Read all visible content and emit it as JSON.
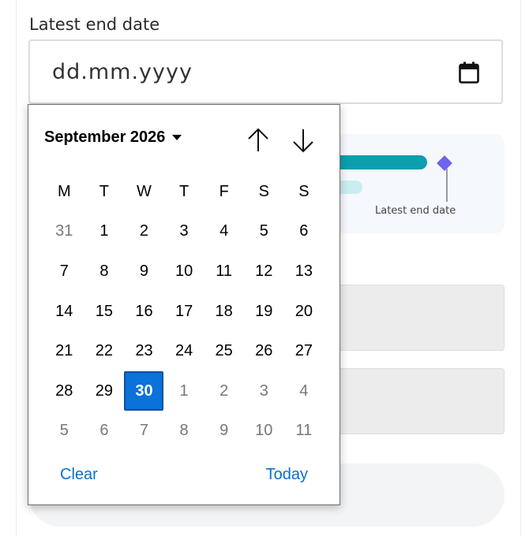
{
  "field": {
    "label": "Latest end date",
    "placeholder": "dd.mm.yyyy"
  },
  "timeline": {
    "marker_label": "Latest end date",
    "colors": {
      "bar": "#0c9fb0",
      "bar_light": "#c9edf1",
      "marker": "#6c63f0"
    }
  },
  "picker": {
    "month_label": "September 2026",
    "weekdays": [
      "M",
      "T",
      "W",
      "T",
      "F",
      "S",
      "S"
    ],
    "weeks": [
      [
        {
          "d": "31",
          "m": true
        },
        {
          "d": "1"
        },
        {
          "d": "2"
        },
        {
          "d": "3"
        },
        {
          "d": "4"
        },
        {
          "d": "5"
        },
        {
          "d": "6"
        }
      ],
      [
        {
          "d": "7"
        },
        {
          "d": "8"
        },
        {
          "d": "9"
        },
        {
          "d": "10"
        },
        {
          "d": "11"
        },
        {
          "d": "12"
        },
        {
          "d": "13"
        }
      ],
      [
        {
          "d": "14"
        },
        {
          "d": "15"
        },
        {
          "d": "16"
        },
        {
          "d": "17"
        },
        {
          "d": "18"
        },
        {
          "d": "19"
        },
        {
          "d": "20"
        }
      ],
      [
        {
          "d": "21"
        },
        {
          "d": "22"
        },
        {
          "d": "23"
        },
        {
          "d": "24"
        },
        {
          "d": "25"
        },
        {
          "d": "26"
        },
        {
          "d": "27"
        }
      ],
      [
        {
          "d": "28"
        },
        {
          "d": "29"
        },
        {
          "d": "30",
          "s": true
        },
        {
          "d": "1",
          "m": true
        },
        {
          "d": "2",
          "m": true
        },
        {
          "d": "3",
          "m": true
        },
        {
          "d": "4",
          "m": true
        }
      ],
      [
        {
          "d": "5",
          "m": true
        },
        {
          "d": "6",
          "m": true
        },
        {
          "d": "7",
          "m": true
        },
        {
          "d": "8",
          "m": true
        },
        {
          "d": "9",
          "m": true
        },
        {
          "d": "10",
          "m": true
        },
        {
          "d": "11",
          "m": true
        }
      ]
    ],
    "clear_label": "Clear",
    "today_label": "Today",
    "selected_color": "#0a72d8"
  }
}
